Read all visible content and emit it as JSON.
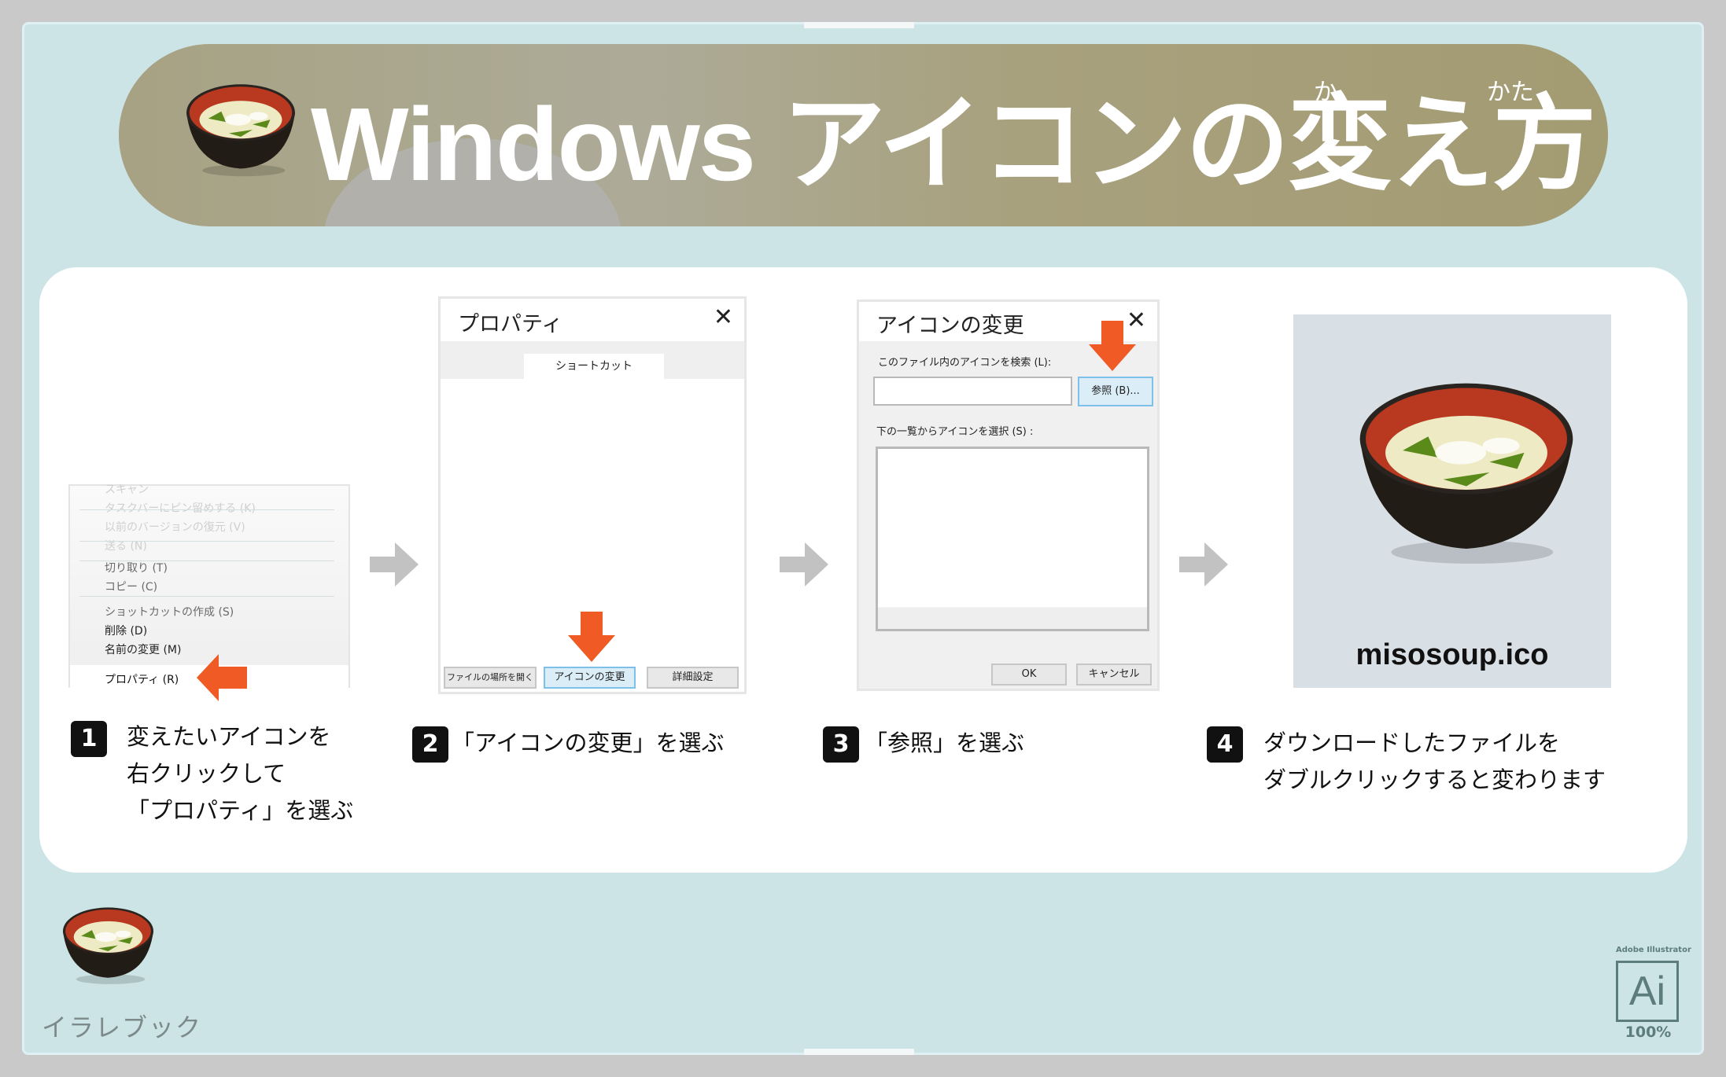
{
  "header": {
    "title": "Windows アイコンの変え方",
    "ruby_ka": "か",
    "ruby_kata": "かた"
  },
  "context_menu": {
    "items": [
      {
        "label": "スキャン",
        "state": "faded"
      },
      {
        "label": "タスクバーにピン留めする (K)",
        "state": "faded"
      },
      {
        "label": "以前のバージョンの復元 (V)",
        "state": "faded"
      },
      {
        "label": "送る (N)",
        "state": "faded"
      },
      {
        "label": "切り取り (T)",
        "state": "dim"
      },
      {
        "label": "コピー (C)",
        "state": "dim"
      },
      {
        "label": "ショットカットの作成 (S)",
        "state": "dim"
      },
      {
        "label": "削除 (D)",
        "state": "normal"
      },
      {
        "label": "名前の変更 (M)",
        "state": "normal"
      },
      {
        "label": "プロパティ (R)",
        "state": "selected"
      }
    ]
  },
  "properties_dialog": {
    "title": "プロパティ",
    "tab": "ショートカット",
    "buttons": [
      "ファイルの場所を開く",
      "アイコンの変更",
      "詳細設定"
    ]
  },
  "icon_dialog": {
    "title": "アイコンの変更",
    "search_label": "このファイル内のアイコンを検索 (L):",
    "search_value": "",
    "browse": "参照 (B)...",
    "list_label": "下の一覧からアイコンを選択 (S) :",
    "ok": "OK",
    "cancel": "キャンセル"
  },
  "result": {
    "filename": "misosoup.ico"
  },
  "steps": [
    {
      "num": "1",
      "lines": [
        "変えたいアイコンを",
        "右クリックして",
        "「プロパティ」を選ぶ"
      ]
    },
    {
      "num": "2",
      "lines": [
        "「アイコンの変更」を選ぶ"
      ]
    },
    {
      "num": "3",
      "lines": [
        "「参照」を選ぶ"
      ]
    },
    {
      "num": "4",
      "lines": [
        "ダウンロードしたファイルを",
        "ダブルクリックすると変わります"
      ]
    }
  ],
  "footer": {
    "brand": "イラレブック",
    "app_label": "Adobe Illustrator",
    "app_icon": "Ai",
    "zoom": "100%"
  },
  "colors": {
    "accent_arrow": "#f05a24",
    "panel": "#cce4e5",
    "header": "#a8a17e"
  }
}
